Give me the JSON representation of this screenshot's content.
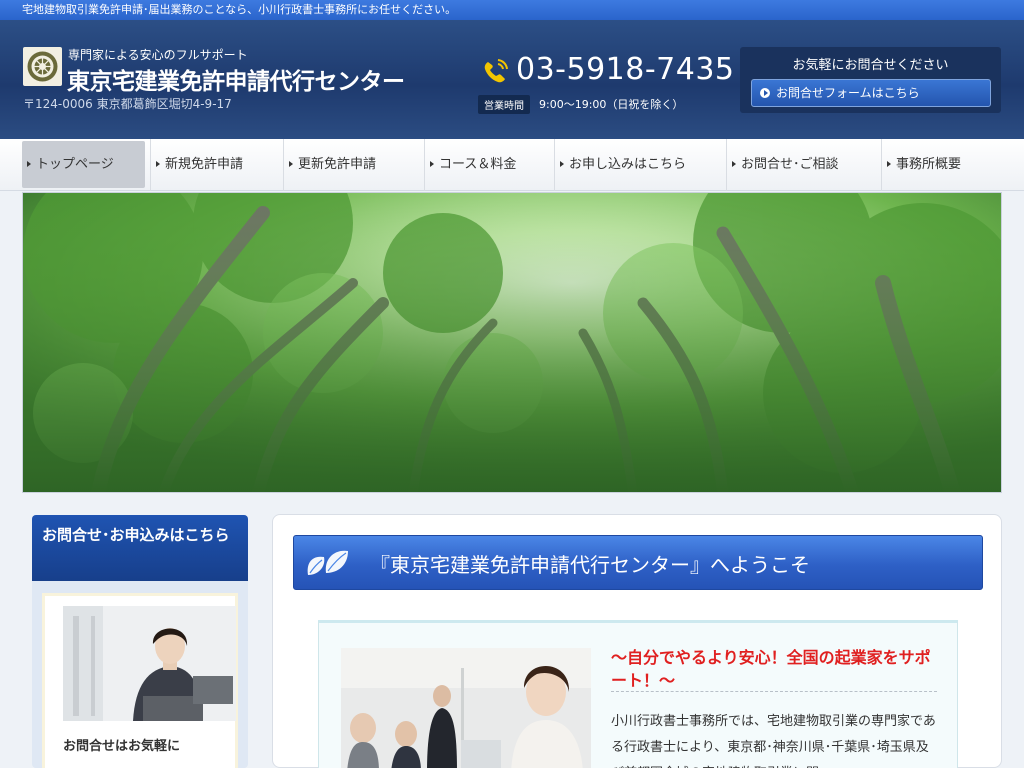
{
  "topbar": {
    "text": "宅地建物取引業免許申請･届出業務のことなら、小川行政書士事務所にお任せください。"
  },
  "header": {
    "subtitle": "専門家による安心のフルサポート",
    "title": "東京宅建業免許申請代行センター",
    "address": "〒124-0006 東京都葛飾区堀切4-9-17",
    "phone": "03-5918-7435",
    "hours_label": "営業時間",
    "hours": "9:00～19:00（日祝を除く）",
    "contact_title": "お気軽にお問合せください",
    "contact_button": "お問合せフォームはこちら"
  },
  "nav": {
    "items": [
      {
        "label": "トップページ"
      },
      {
        "label": "新規免許申請"
      },
      {
        "label": "更新免許申請"
      },
      {
        "label": "コース＆料金"
      },
      {
        "label": "お申し込みはこちら"
      },
      {
        "label": "お問合せ･ご相談"
      },
      {
        "label": "事務所概要"
      }
    ],
    "active_index": 0
  },
  "sidebar": {
    "heading": "お問合せ･お申込みはこちら",
    "caption": "お問合せはお気軽に"
  },
  "main": {
    "welcome": "『東京宅建業免許申請代行センター』へようこそ",
    "feature_heading": "～自分でやるより安心！全国の起業家をサポート！～",
    "feature_body": "小川行政書士事務所では、宅地建物取引業の専門家である行政書士により、東京都･神奈川県･千葉県･埼玉県及び首都圏全域の宅地建物取引業に関"
  },
  "colors": {
    "topbar": "#2f6fd8",
    "header": "#1e3a6e",
    "accent_blue": "#2e60c6",
    "feature_heading": "#e02020"
  }
}
